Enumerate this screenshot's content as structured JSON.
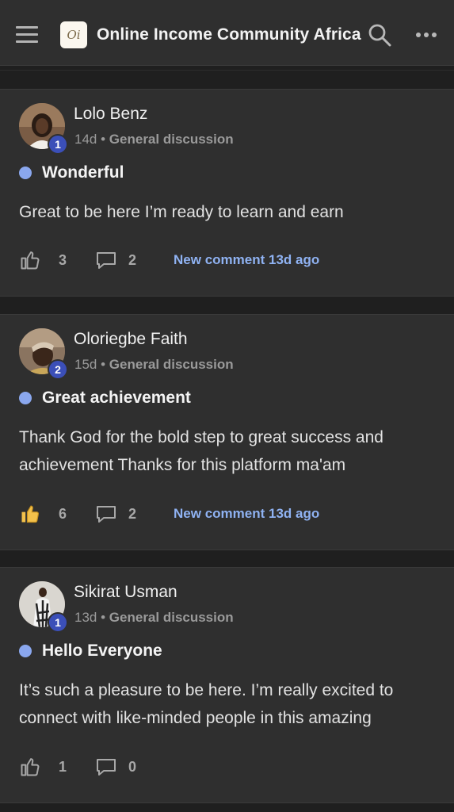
{
  "header": {
    "title": "Online Income Community Africa",
    "logo_text": "Oi"
  },
  "posts": [
    {
      "author": "Lolo Benz",
      "badge": "1",
      "time": "14d",
      "separator": "•",
      "category": "General discussion",
      "title": "Wonderful",
      "body": "Great to be here I’m ready to learn and earn",
      "likes": "3",
      "comments": "2",
      "new_comment": "New comment 13d ago",
      "liked": false
    },
    {
      "author": "Oloriegbe Faith",
      "badge": "2",
      "time": "15d",
      "separator": "•",
      "category": "General discussion",
      "title": "Great achievement",
      "body": "Thank God for the bold step to great success and achievement Thanks for this platform ma'am",
      "likes": "6",
      "comments": "2",
      "new_comment": "New comment 13d ago",
      "liked": true
    },
    {
      "author": "Sikirat Usman",
      "badge": "1",
      "time": "13d",
      "separator": "•",
      "category": "General discussion",
      "title": "Hello Everyone",
      "body": "It’s such a pleasure to be here. I’m really excited to connect with like-minded people in this amazing",
      "likes": "1",
      "comments": "0"
    }
  ],
  "colors": {
    "accent_blue": "#8fb2f2",
    "badge_blue": "#3b4fb8",
    "liked_yellow": "#f3c14b"
  }
}
